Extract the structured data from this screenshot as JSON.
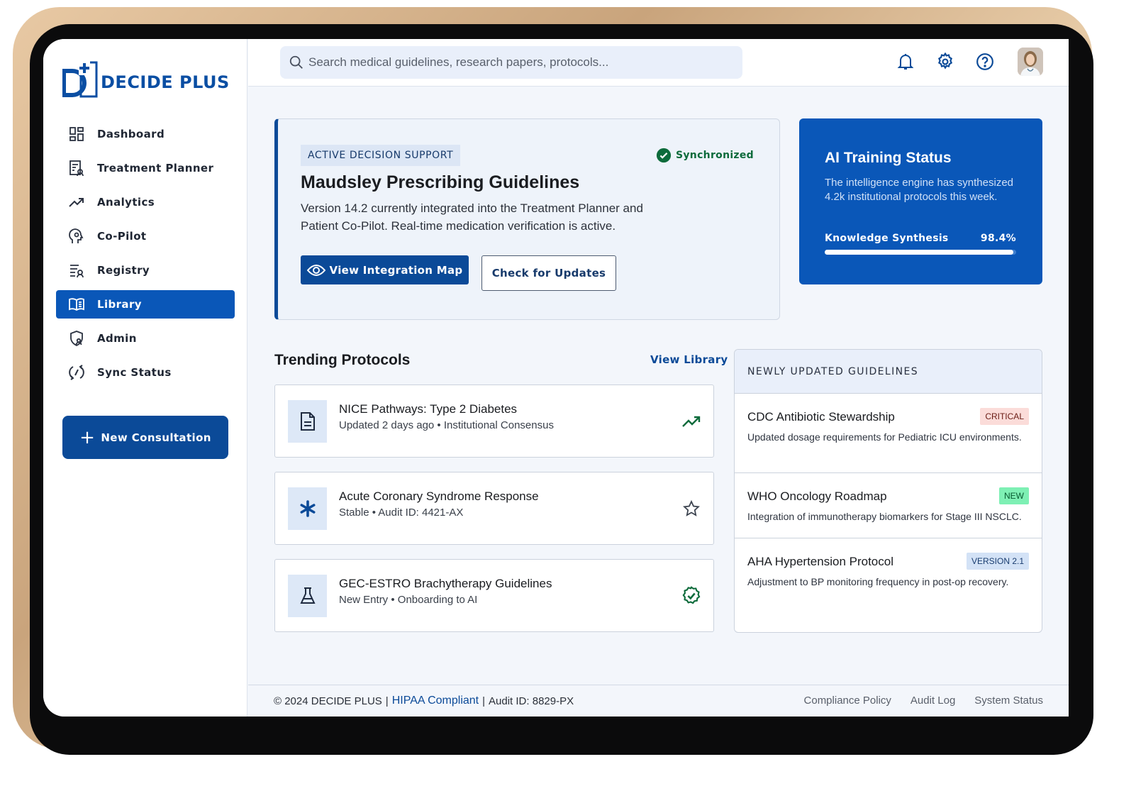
{
  "brand": {
    "logo_letter": "D",
    "name": "DECIDE PLUS",
    "color": "#0a4ea3"
  },
  "sidebar": {
    "items": [
      {
        "label": "Dashboard",
        "icon": "dashboard-icon",
        "active": false
      },
      {
        "label": "Treatment Planner",
        "icon": "treatment-planner-icon",
        "active": false
      },
      {
        "label": "Analytics",
        "icon": "analytics-trend-icon",
        "active": false
      },
      {
        "label": "Co-Pilot",
        "icon": "head-brain-icon",
        "active": false
      },
      {
        "label": "Registry",
        "icon": "registry-list-icon",
        "active": false
      },
      {
        "label": "Library",
        "icon": "open-book-icon",
        "active": true
      },
      {
        "label": "Admin",
        "icon": "shield-person-icon",
        "active": false
      },
      {
        "label": "Sync Status",
        "icon": "sync-icon",
        "active": false
      }
    ],
    "new_consultation_label": "New Consultation"
  },
  "topbar": {
    "search_placeholder": "Search medical guidelines, research papers, protocols...",
    "icons": [
      "bell-icon",
      "gear-icon",
      "help-icon",
      "user-avatar"
    ]
  },
  "hero": {
    "tag": "ACTIVE DECISION SUPPORT",
    "status": "Synchronized",
    "title": "Maudsley Prescribing Guidelines",
    "description": "Version 14.2 currently integrated into the Treatment Planner and Patient Co-Pilot. Real-time medication verification is active.",
    "primary_button": "View Integration Map",
    "secondary_button": "Check for Updates"
  },
  "ai_training": {
    "title": "AI Training Status",
    "description": "The intelligence engine has synthesized 4.2k institutional protocols this week.",
    "metric_label": "Knowledge Synthesis",
    "metric_value": "98.4%",
    "progress": 0.984
  },
  "trending": {
    "title": "Trending Protocols",
    "view_all": "View Library",
    "items": [
      {
        "title": "NICE Pathways: Type 2 Diabetes",
        "subtitle": "Updated 2 days ago • Institutional Consensus",
        "icon": "document-icon",
        "action_icon": "trending-up-icon"
      },
      {
        "title": "Acute Coronary Syndrome Response",
        "subtitle": "Stable • Audit ID: 4421-AX",
        "icon": "asterisk-icon",
        "action_icon": "star-icon"
      },
      {
        "title": "GEC-ESTRO Brachytherapy Guidelines",
        "subtitle": "New Entry • Onboarding to AI",
        "icon": "flask-icon",
        "action_icon": "verified-badge-icon"
      }
    ]
  },
  "guidelines": {
    "title": "NEWLY UPDATED GUIDELINES",
    "items": [
      {
        "title": "CDC Antibiotic Stewardship",
        "description": "Updated dosage requirements for Pediatric ICU environments.",
        "badge": "CRITICAL",
        "badge_type": "critical"
      },
      {
        "title": "WHO Oncology Roadmap",
        "description": "Integration of immunotherapy biomarkers for Stage III NSCLC.",
        "badge": "NEW",
        "badge_type": "new"
      },
      {
        "title": "AHA Hypertension Protocol",
        "description": "Adjustment to BP monitoring frequency in post-op recovery.",
        "badge": "VERSION 2.1",
        "badge_type": "version"
      }
    ]
  },
  "footer": {
    "copyright": "© 2024 DECIDE PLUS",
    "hipaa": "HIPAA Compliant",
    "audit": "Audit ID: 8829-PX",
    "links": [
      "Compliance Policy",
      "Audit Log",
      "System Status"
    ]
  },
  "colors": {
    "primary": "#0b4a98",
    "accent_blue": "#0a57b8",
    "success": "#0d6b3b",
    "background": "#f3f6fb"
  }
}
